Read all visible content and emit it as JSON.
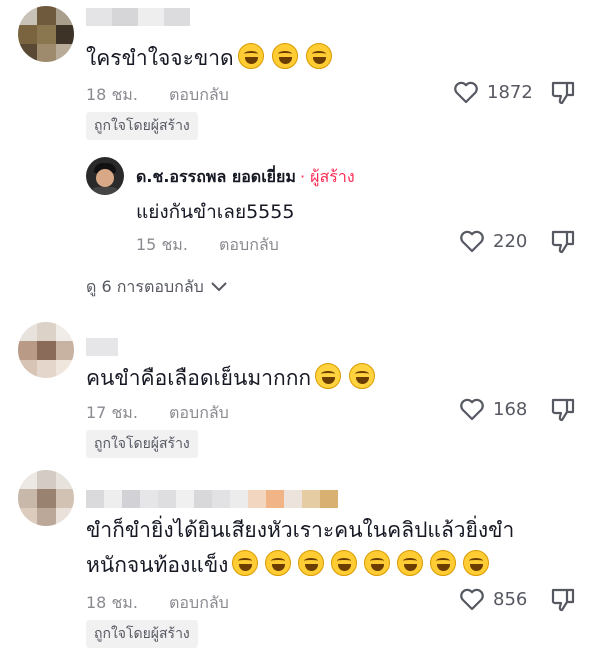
{
  "comments": [
    {
      "text": "ใครขำใจจะขาด",
      "emoji_count": 3,
      "time": "18 ชม.",
      "reply_label": "ตอบกลับ",
      "likes": "1872",
      "badge": "ถูกใจโดยผู้สร้าง"
    },
    {
      "text": "คนขำคือเลือดเย็นมากกก",
      "emoji_count": 2,
      "time": "17 ชม.",
      "reply_label": "ตอบกลับ",
      "likes": "168",
      "badge": "ถูกใจโดยผู้สร้าง"
    },
    {
      "text_line1": "ขำก็ขำยิ่งได้ยินเสียงหัวเราะคนในคลิปแล้วยิ่งขำ",
      "text_line2": "หนักจนท้องแข็ง",
      "emoji_count": 8,
      "time": "18 ชม.",
      "reply_label": "ตอบกลับ",
      "likes": "856",
      "badge": "ถูกใจโดยผู้สร้าง"
    }
  ],
  "reply": {
    "author": "ด.ช.อรรถพล ยอดเยี่ยม",
    "creator_tag": "· ผู้สร้าง",
    "text": "แย่งกันขำเลย5555",
    "time": "15 ชม.",
    "reply_label": "ตอบกลับ",
    "likes": "220"
  },
  "view_replies": "ดู 6 การตอบกลับ",
  "icons": {
    "like": "heart-outline-icon",
    "dislike": "thumbs-down-outline-icon",
    "expand": "chevron-down-icon",
    "emoji_laugh": "tears-of-joy-emoji",
    "emoji_sweat": "grinning-sweat-emoji"
  }
}
